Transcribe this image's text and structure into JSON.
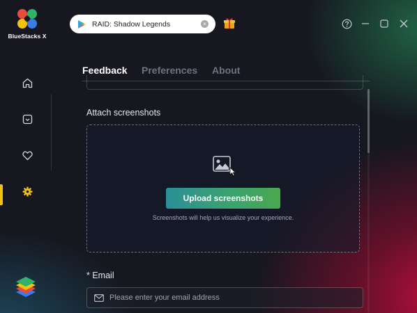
{
  "app": {
    "brand_name": "BlueStacks X"
  },
  "search": {
    "query": "RAID: Shadow Legends",
    "clear_glyph": "×"
  },
  "tabs": [
    {
      "label": "Feedback",
      "active": true
    },
    {
      "label": "Preferences",
      "active": false
    },
    {
      "label": "About",
      "active": false
    }
  ],
  "sidebar": {
    "items": [
      {
        "icon": "home-icon"
      },
      {
        "icon": "games-library-icon"
      },
      {
        "icon": "heart-icon"
      },
      {
        "icon": "settings-icon",
        "active": true
      }
    ],
    "active_color": "#f2c20c"
  },
  "window_controls": [
    "help-icon",
    "minimize-icon",
    "maximize-icon",
    "close-icon"
  ],
  "attach": {
    "title": "Attach screenshots",
    "button_label": "Upload screenshots",
    "hint": "Screenshots will help us visualize your experience."
  },
  "email": {
    "label": "* Email",
    "placeholder": "Please enter your email address",
    "value": ""
  },
  "colors": {
    "background": "#16171f",
    "button_gradient_start": "#2a8f97",
    "button_gradient_end": "#4aa84e",
    "accent": "#f2c20c"
  }
}
